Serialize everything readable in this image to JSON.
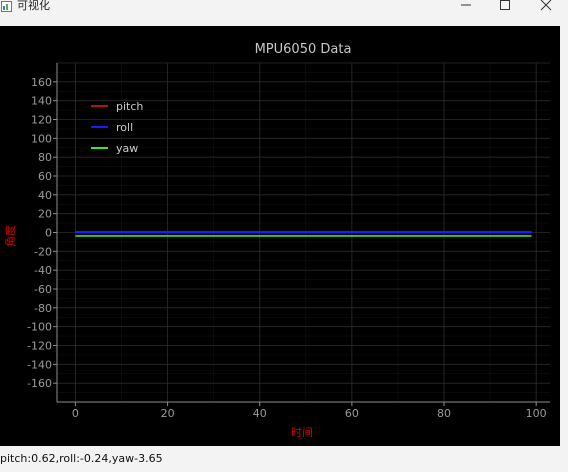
{
  "window": {
    "title": "可视化",
    "buttons": [
      "minimize",
      "maximize",
      "close"
    ]
  },
  "status": {
    "text": "pitch:0.62,roll:-0.24,yaw-3.65"
  },
  "colors": {
    "background": "#000000",
    "grid": "#2b2b2b",
    "axis": "#8c8c8c",
    "tick_text": "#9a9a9a",
    "title_text": "#c8c8c8",
    "axis_label": "#d40000"
  },
  "chart_data": {
    "type": "line",
    "title": "MPU6050 Data",
    "xlabel": "时间",
    "ylabel": "角度",
    "xlim": [
      -4,
      103
    ],
    "ylim": [
      -180,
      180
    ],
    "xticks": [
      0,
      20,
      40,
      60,
      80,
      100
    ],
    "yticks": [
      160,
      140,
      120,
      100,
      80,
      60,
      40,
      20,
      0,
      -20,
      -40,
      -60,
      -80,
      -100,
      -120,
      -140,
      -160
    ],
    "grid": true,
    "legend": "top-left",
    "series": [
      {
        "name": "pitch",
        "color": "#b01414",
        "x": [
          0,
          99
        ],
        "values": [
          0.62,
          0.62
        ]
      },
      {
        "name": "roll",
        "color": "#1a1aff",
        "x": [
          0,
          99
        ],
        "values": [
          -0.24,
          -0.24
        ]
      },
      {
        "name": "yaw",
        "color": "#39e639",
        "x": [
          0,
          99
        ],
        "values": [
          -3.65,
          -3.65
        ]
      }
    ]
  }
}
